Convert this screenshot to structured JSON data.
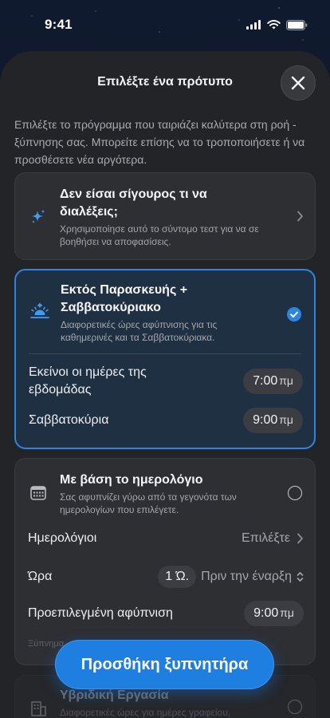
{
  "status": {
    "time": "9:41"
  },
  "header": {
    "title": "Επιλέξτε ένα πρότυπο"
  },
  "intro": "Επιλέξτε το πρόγραμμα που ταιριάζει καλύτερα στη ροή ­­ξύπνησης σας. Μπορείτε επίσης να το τροποποιήσετε ή να προσθέσετε νέα αργότερα.",
  "cards": {
    "unsure": {
      "title": "Δεν είσαι σίγουρος τι να διαλέξεις;",
      "subtitle": "Χρησιμοποίησε αυτό το σύντομο τεστ για να σε βοηθήσει να αποφασίσεις."
    },
    "weekend": {
      "title": "Εκτός Παρασκευής + Σαββατοκύριακο",
      "subtitle": "Διαφορετικές ώρες αφύπνισης για τις καθημερινές και τα Σαββατοκύριακα.",
      "weekdays_label": "Εκείνοι οι ημέρες της εβδομάδας",
      "weekdays_time": "7:00",
      "weekend_label": "Σαββατοκύρια",
      "weekend_time": "9:00",
      "time_unit": "πμ",
      "selected": true
    },
    "calendar": {
      "title": "Με βάση το ημερολόγιο",
      "subtitle": "Σας αφυπνίζει γύρω από τα γεγονότα των ημερολογίων που επιλέγετε.",
      "calendars_label": "Ημερολόγιοι",
      "calendars_value": "Επιλέξτε",
      "time_label": "Ώρα",
      "time_amount": "1 Ώ.",
      "time_relation": "Πριν την έναρξη",
      "default_label": "Προεπιλεγμένη αφύπνιση",
      "default_time": "9:00",
      "time_unit": "πμ",
      "footer_partial": "Ξύπνημα"
    },
    "hybrid": {
      "title": "Υβριδική Εργασία",
      "subtitle": "Διαφορετικές ώρες για ημέρες γραφείου,"
    }
  },
  "cta": {
    "label": "Προσθήκη ξυπνητήρα"
  },
  "colors": {
    "accent": "#1f7fe0",
    "sheet": "#232427",
    "card": "#2e2f33"
  }
}
